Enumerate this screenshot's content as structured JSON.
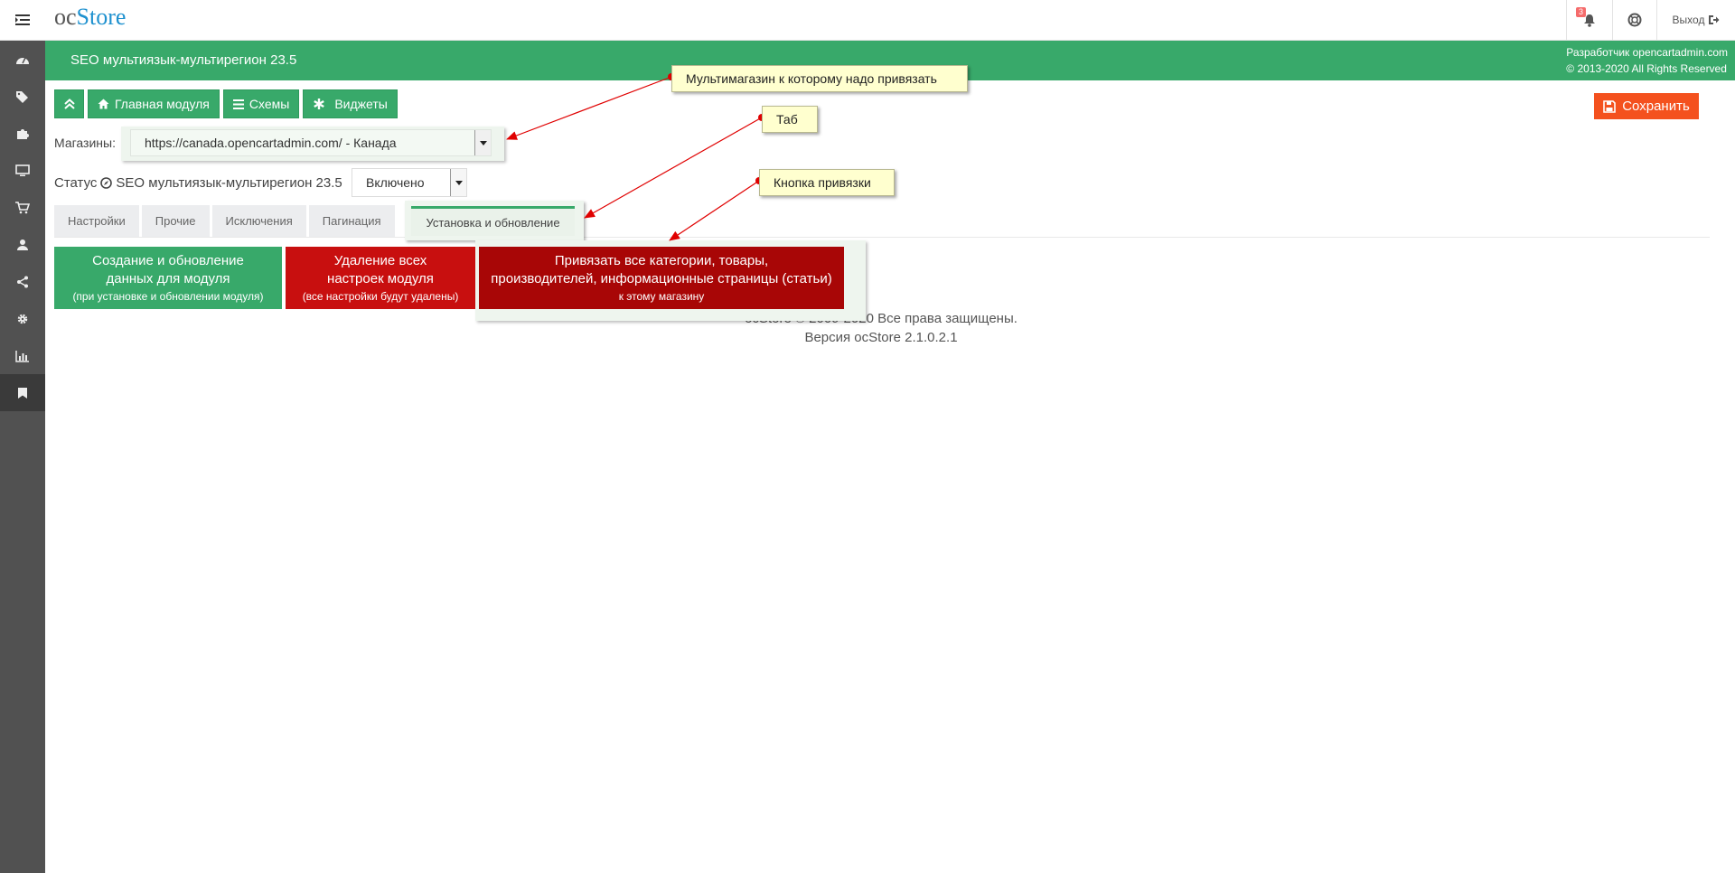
{
  "app": {
    "logo_oc": "oc",
    "logo_store": "Store",
    "notification_count": "3",
    "logout_label": "Выход"
  },
  "header": {
    "title": "SEO мультиязык-мультирегион 23.5",
    "developer": "Разработчик opencartadmin.com",
    "copyright": "© 2013-2020 All Rights Reserved"
  },
  "toolbar": {
    "main_label": "Главная модуля",
    "schemes_label": "Схемы",
    "widgets_label": "Виджеты",
    "save_label": "Сохранить"
  },
  "stores": {
    "label": "Магазины:",
    "selected": "https://canada.opencartadmin.com/ - Канада"
  },
  "status": {
    "label_prefix": "Статус",
    "label_module": "SEO мультиязык-мультирегион 23.5",
    "selected": "Включено"
  },
  "tabs": [
    {
      "label": "Настройки"
    },
    {
      "label": "Прочие"
    },
    {
      "label": "Исключения"
    },
    {
      "label": "Пагинация"
    },
    {
      "label": "Установка и обновление"
    }
  ],
  "actions": {
    "create": {
      "line1": "Создание и обновление",
      "line2": "данных для модуля",
      "line3": "(при установке и обновлении модуля)"
    },
    "delete": {
      "line1": "Удаление всех",
      "line2": "настроек модуля",
      "line3": "(все настройки будут удалены)"
    },
    "bind": {
      "line1": "Привязать все категории, товары,",
      "line2": "производителей, информационные страницы (статьи)",
      "line3": "к этому магазину"
    }
  },
  "footer": {
    "line1": "ocStore © 2009-2020 Все права защищены.",
    "line2": "Версия ocStore 2.1.0.2.1"
  },
  "annotations": {
    "store": "Мультимагазин к которому надо привязать",
    "tab": "Таб",
    "bind": "Кнопка привязки"
  },
  "colors": {
    "green": "#38a96a",
    "red": "#c80f0f",
    "dark_red": "#a80606",
    "orange": "#f4511e",
    "sidebar": "#515151",
    "logo_blue": "#1e91cf",
    "callout": "#ffffcf"
  }
}
